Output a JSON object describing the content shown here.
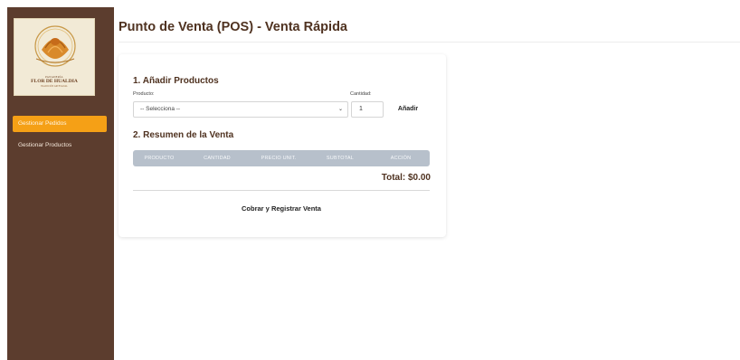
{
  "sidebar": {
    "logo": {
      "line1": "PANADERÍA",
      "line2": "FLOR DE HUALDIA",
      "line3": "TRADICIÓN ARTESANAL"
    },
    "items": [
      {
        "label": "Gestionar Pedidos",
        "active": true
      },
      {
        "label": "Gestionar Productos",
        "active": false
      }
    ],
    "colors": {
      "background": "#5c3d2e",
      "active": "#f5a016"
    }
  },
  "header": {
    "title": "Punto de Venta (POS) - Venta Rápida"
  },
  "add_products": {
    "title": "1. Añadir Productos",
    "product_label": "Producto:",
    "product_selected": "-- Selecciona --",
    "quantity_label": "Cantidad:",
    "quantity_value": "1",
    "add_button": "Añadir"
  },
  "summary": {
    "title": "2. Resumen de la Venta",
    "columns": [
      "PRODUCTO",
      "CANTIDAD",
      "PRECIO UNIT.",
      "SUBTOTAL",
      "ACCIÓN"
    ],
    "rows": [],
    "total": "Total: $0.00",
    "checkout_button": "Cobrar y Registrar Venta"
  }
}
